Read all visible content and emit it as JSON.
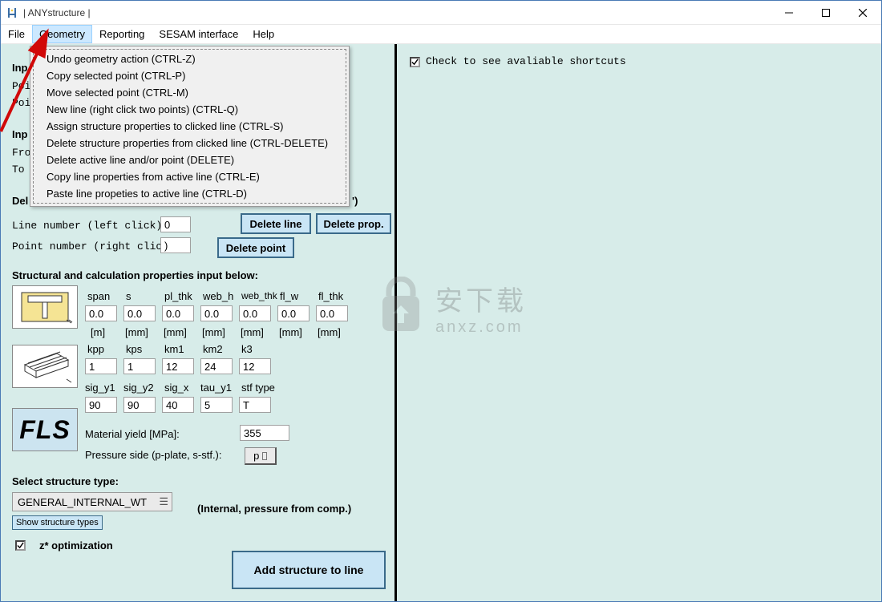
{
  "title": "| ANYstructure |",
  "menu": {
    "file": "File",
    "geometry": "Geometry",
    "reporting": "Reporting",
    "sesam": "SESAM interface",
    "help": "Help"
  },
  "dropdown": [
    "Undo geometry action (CTRL-Z)",
    "Copy selected point (CTRL-P)",
    "Move selected point (CTRL-M)",
    "New line (right click two points) (CTRL-Q)",
    "Assign structure properties to clicked line (CTRL-S)",
    "Delete structure properties from clicked line (CTRL-DELETE)",
    "Delete active line and/or point (DELETE)",
    "Copy line properties from active line (CTRL-E)",
    "Paste line propeties to active line (CTRL-D)"
  ],
  "bg": {
    "inp1": "Inp",
    "poi1": "Poi",
    "poi2": "Poi",
    "inp2": "Inp",
    "fro": "Fro",
    "to": "To",
    "del": "Del",
    "del_end": "')",
    "line_num": "Line number (left click):",
    "point_num": "Point number (right click):",
    "line_val": "0",
    "point_val": ")",
    "btn_delete_line": "Delete line",
    "btn_delete_prop": "Delete prop.",
    "btn_delete_point": "Delete point",
    "struct_title": "Structural and calculation properties input below:"
  },
  "cols": {
    "span": "span",
    "s": "s",
    "pl_thk": "pl_thk",
    "web_h": "web_h",
    "web_thk": "web_thk",
    "fl_w": "fl_w",
    "fl_thk": "fl_thk"
  },
  "units": {
    "m": "[m]",
    "mm": "[mm]"
  },
  "vals_r1": {
    "span": "0.0",
    "s": "0.0",
    "pl_thk": "0.0",
    "web_h": "0.0",
    "web_thk": "0.0",
    "fl_w": "0.0",
    "fl_thk": "0.0"
  },
  "row2": {
    "kpp": "kpp",
    "kps": "kps",
    "km1": "km1",
    "km2": "km2",
    "k3": "k3"
  },
  "vals_r2": {
    "kpp": "1",
    "kps": "1",
    "km1": "12",
    "km2": "24",
    "k3": "12"
  },
  "row3": {
    "sig_y1": "sig_y1",
    "sig_y2": "sig_y2",
    "sig_x": "sig_x",
    "tau_y1": "tau_y1",
    "stf_type": "stf type"
  },
  "vals_r3": {
    "sig_y1": "90",
    "sig_y2": "90",
    "sig_x": "40",
    "tau_y1": "5",
    "stf_type": "T"
  },
  "mat_yield_label": "Material yield [MPa]:",
  "mat_yield_val": "355",
  "pressure_label": "Pressure side (p-plate, s-stf.):",
  "p_btn": "p",
  "select_label": "Select structure type:",
  "select_value": "GENERAL_INTERNAL_WT",
  "show_types": "Show structure types",
  "internal_note": "(Internal, pressure from comp.)",
  "z_opt": "z* optimization",
  "add_struct": "Add structure to line",
  "fls": "FLS",
  "right_check": "Check to see avaliable shortcuts",
  "watermark_main": "安下载",
  "watermark_sub": "anxz.com"
}
